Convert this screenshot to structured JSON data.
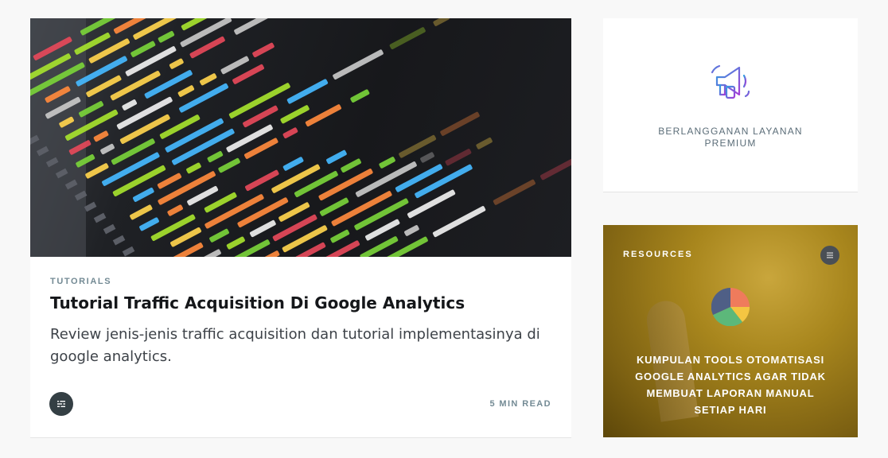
{
  "main_post": {
    "image": "code-editor-screenshot",
    "category": "TUTORIALS",
    "title": "Tutorial Traffic Acquisition Di Google Analytics",
    "excerpt": "Review jenis-jenis traffic acquisition dan tutorial implementasinya di google analytics.",
    "author_icon": "list-icon",
    "read_time": "5 MIN READ"
  },
  "premium": {
    "icon": "megaphone-icon",
    "label": "BERLANGGANAN LAYANAN PREMIUM"
  },
  "resources": {
    "label": "RESOURCES",
    "button_icon": "sliders-icon",
    "icon": "pie-chart-icon",
    "title": "KUMPULAN TOOLS OTOMATISASI GOOGLE ANALYTICS AGAR TIDAK MEMBUAT LAPORAN MANUAL SETIAP HARI"
  },
  "colors": {
    "text_dark": "#15171a",
    "meta_gray": "#738a94",
    "resources_bg": "#a8861d"
  }
}
